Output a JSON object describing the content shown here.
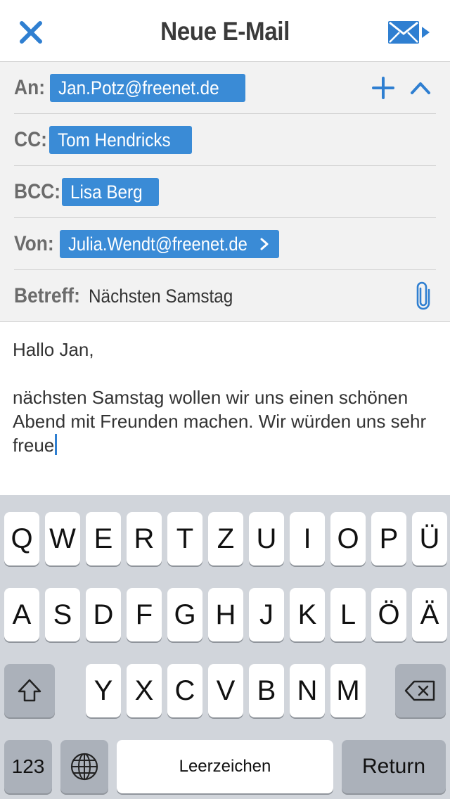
{
  "navbar": {
    "title": "Neue E-Mail",
    "close_icon": "close-icon",
    "send_icon": "send-mail-icon",
    "accent": "#2f7fd1"
  },
  "header": {
    "to": {
      "label": "An:",
      "chip": "Jan.Potz@freenet.de"
    },
    "cc": {
      "label": "CC:",
      "chip": "Tom Hendricks"
    },
    "bcc": {
      "label": "BCC:",
      "chip": "Lisa Berg"
    },
    "from": {
      "label": "Von:",
      "chip": "Julia.Wendt@freenet.de"
    },
    "subject": {
      "label": "Betreff:",
      "value": "Nächsten Samstag"
    },
    "chip_color": "#3a8bd6"
  },
  "body": {
    "greeting": "Hallo Jan,",
    "paragraph": "nächsten Samstag wollen wir uns einen schönen Abend mit Freunden machen. Wir würden uns sehr freue"
  },
  "keyboard": {
    "row1": [
      "Q",
      "W",
      "E",
      "R",
      "T",
      "Z",
      "U",
      "I",
      "O",
      "P",
      "Ü"
    ],
    "row2": [
      "A",
      "S",
      "D",
      "F",
      "G",
      "H",
      "J",
      "K",
      "L",
      "Ö",
      "Ä"
    ],
    "row3": [
      "Y",
      "X",
      "C",
      "V",
      "B",
      "N",
      "M"
    ],
    "numbers_label": "123",
    "space_label": "Leerzeichen",
    "return_label": "Return"
  }
}
